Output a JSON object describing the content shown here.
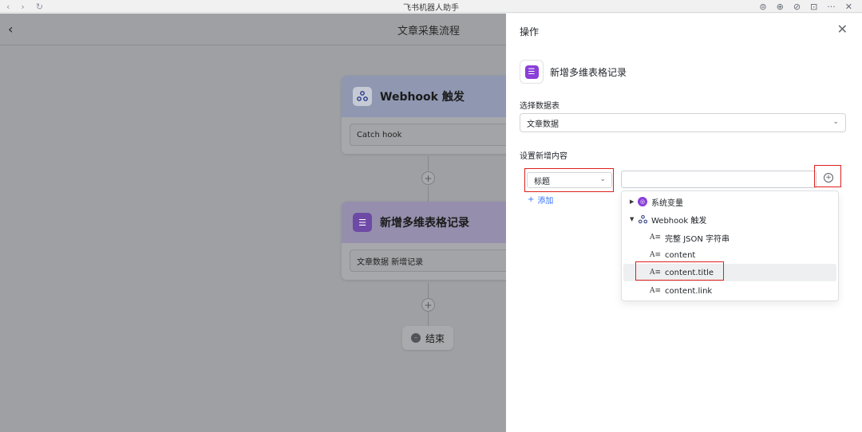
{
  "titlebar": {
    "title": "飞书机器人助手",
    "back": "‹",
    "forward": "›",
    "reload": "↻",
    "right_icons": [
      "⊜",
      "⊕",
      "⊘",
      "⊡",
      "···",
      "✕"
    ]
  },
  "canvas": {
    "back": "‹",
    "flow_title": "文章采集流程",
    "trigger_card": {
      "label": "Webhook 触发",
      "field": "Catch hook"
    },
    "action_card": {
      "label": "新增多维表格记录",
      "field": "文章数据 新增记录",
      "icon_text": "☰"
    },
    "plus": "+",
    "end_label": "结束",
    "end_dot": "–"
  },
  "panel": {
    "title": "操作",
    "close": "✕",
    "action_label": "新增多维表格记录",
    "action_icon_text": "☰",
    "table_label": "选择数据表",
    "table_value": "文章数据",
    "content_label": "设置新增内容",
    "field_value": "标题",
    "add_label": "添加",
    "add_plus": "+",
    "chevron": "⌄",
    "insert": "+"
  },
  "dropdown": {
    "system_vars": "系统变量",
    "webhook_group": "Webhook 触发",
    "text_icon": "A≡",
    "items": [
      "完整 JSON 字符串",
      "content",
      "content.title",
      "content.link"
    ],
    "selected": "content.title"
  },
  "colors": {
    "accent": "#3370ff",
    "annotation_red": "#e02020",
    "purple": "#8a3fd8"
  }
}
